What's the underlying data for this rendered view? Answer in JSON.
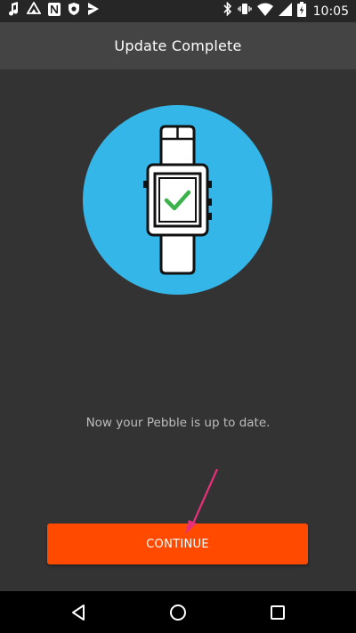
{
  "status_bar": {
    "time": "10:05",
    "left_icons": [
      "music-note-icon",
      "photos-icon",
      "n-notification-icon",
      "shield-icon",
      "send-icon"
    ],
    "right_icons": [
      "bluetooth-icon",
      "vibrate-icon",
      "wifi-icon",
      "signal-icon",
      "battery-icon"
    ]
  },
  "header": {
    "title": "Update Complete"
  },
  "illustration": {
    "icon": "watch-check-icon",
    "circle_color": "#35b6e8",
    "check_color": "#3bb34a"
  },
  "main": {
    "message": "Now your Pebble is up to date."
  },
  "actions": {
    "continue_label": "CONTINUE",
    "continue_color": "#ff4a00",
    "pointer_color": "#e8307a"
  },
  "nav_bar": {
    "icons": [
      "back-icon",
      "home-icon",
      "recents-icon"
    ]
  }
}
